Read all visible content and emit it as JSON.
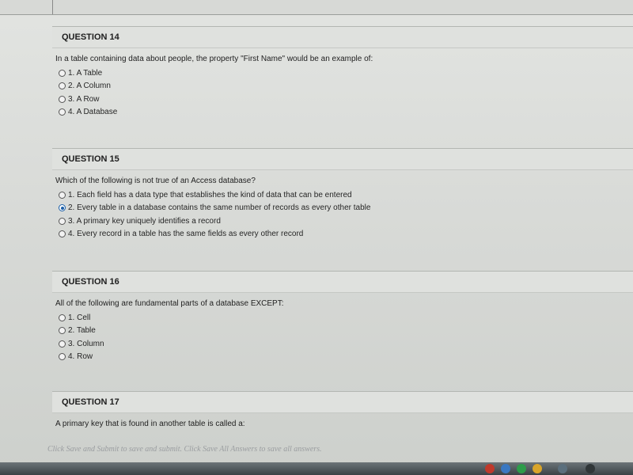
{
  "questions": [
    {
      "header": "QUESTION 14",
      "text": "In a table containing data about people, the property \"First Name\" would be an example of:",
      "options": [
        {
          "label": "1. A Table",
          "selected": false
        },
        {
          "label": "2. A Column",
          "selected": false
        },
        {
          "label": "3. A Row",
          "selected": false
        },
        {
          "label": "4. A Database",
          "selected": false
        }
      ]
    },
    {
      "header": "QUESTION 15",
      "text": "Which of the following is not true of an Access database?",
      "options": [
        {
          "label": "1. Each field has a data type that establishes the kind of data that can be entered",
          "selected": false
        },
        {
          "label": "2. Every table in a database contains the same number of records as every other table",
          "selected": true
        },
        {
          "label": "3. A primary key uniquely identifies a record",
          "selected": false
        },
        {
          "label": "4. Every record in a table has the same fields as every other record",
          "selected": false
        }
      ]
    },
    {
      "header": "QUESTION 16",
      "text": "All of the following are fundamental parts of a database EXCEPT:",
      "options": [
        {
          "label": "1. Cell",
          "selected": false
        },
        {
          "label": "2. Table",
          "selected": false
        },
        {
          "label": "3. Column",
          "selected": false
        },
        {
          "label": "4. Row",
          "selected": false
        }
      ]
    },
    {
      "header": "QUESTION 17",
      "text": "A primary key that is found in another table is called a:",
      "options": []
    }
  ],
  "footer": {
    "text": "Click Save and Submit to save and submit. Click Save All Answers to save all answers."
  }
}
